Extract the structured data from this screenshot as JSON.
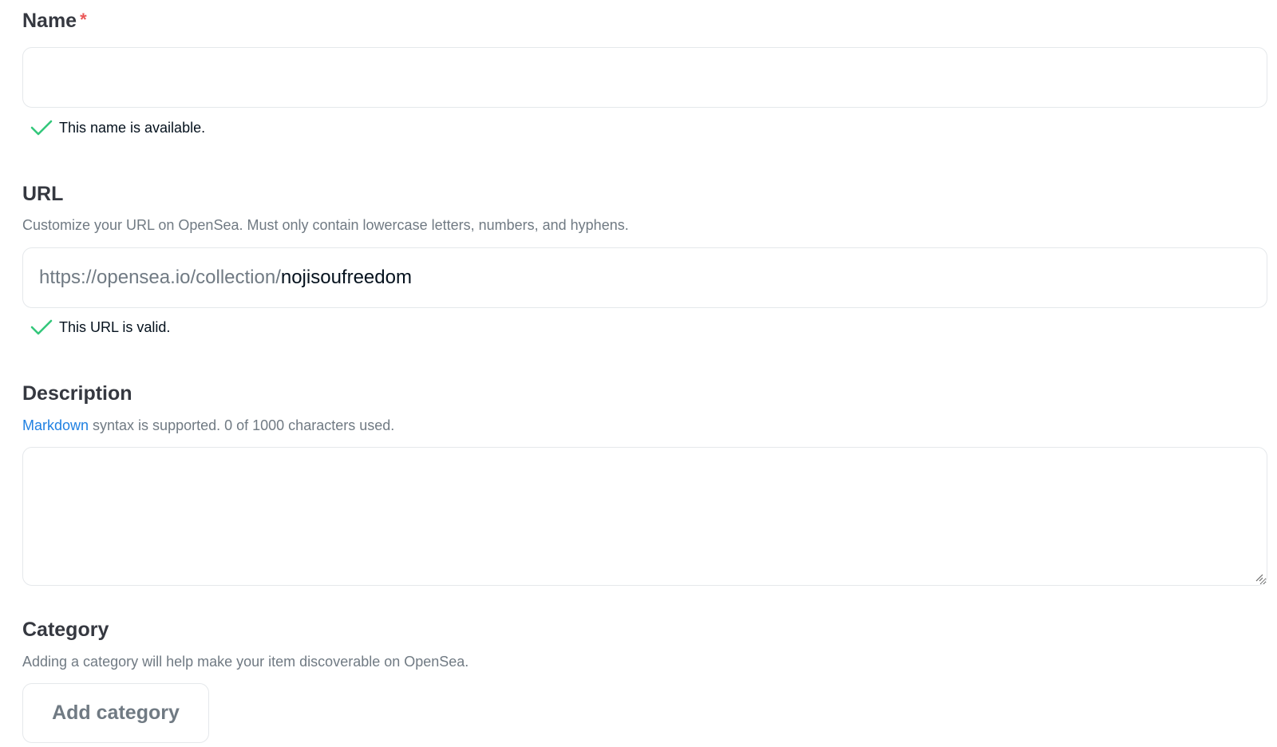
{
  "name_section": {
    "label": "Name",
    "required_marker": "*",
    "input_value": "",
    "validation_text": "This name is available."
  },
  "url_section": {
    "label": "URL",
    "hint": "Customize your URL on OpenSea. Must only contain lowercase letters, numbers, and hyphens.",
    "prefix": "https://opensea.io/collection/",
    "value": "nojisoufreedom",
    "validation_text": "This URL is valid."
  },
  "description_section": {
    "label": "Description",
    "markdown_link": "Markdown",
    "hint_rest": " syntax is supported. 0 of 1000 characters used.",
    "value": ""
  },
  "category_section": {
    "label": "Category",
    "hint": "Adding a category will help make your item discoverable on OpenSea.",
    "button_label": "Add category"
  },
  "colors": {
    "check": "#34c77b",
    "required": "#eb5757",
    "link": "#2081e2",
    "border": "#e5e8eb"
  },
  "icons": {
    "validation": "checkmark-icon",
    "resize": "resize-grip-icon"
  }
}
